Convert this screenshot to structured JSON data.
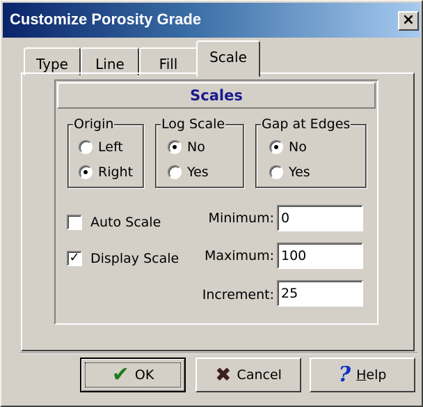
{
  "window": {
    "title": "Customize Porosity Grade",
    "close_label": "×"
  },
  "tabs": [
    {
      "label": "Type"
    },
    {
      "label": "Line"
    },
    {
      "label": "Fill"
    },
    {
      "label": "Scale",
      "selected": true
    }
  ],
  "scales": {
    "header": "Scales",
    "origin": {
      "title": "Origin",
      "options": [
        "Left",
        "Right"
      ],
      "selected": "Right"
    },
    "log_scale": {
      "title": "Log Scale",
      "options": [
        "No",
        "Yes"
      ],
      "selected": "No"
    },
    "gap_at_edges": {
      "title": "Gap at Edges",
      "options": [
        "No",
        "Yes"
      ],
      "selected": "No"
    },
    "auto_scale": {
      "label": "Auto Scale",
      "checked": false,
      "mark": ""
    },
    "display_scale": {
      "label": "Display Scale",
      "checked": true,
      "mark": "✓"
    },
    "minimum": {
      "label": "Minimum:",
      "value": "0"
    },
    "maximum": {
      "label": "Maximum:",
      "value": "100"
    },
    "increment": {
      "label": "Increment:",
      "value": "25"
    }
  },
  "buttons": {
    "ok": {
      "label": "OK",
      "icon": "check-icon"
    },
    "cancel": {
      "label": "Cancel",
      "icon": "x-icon"
    },
    "help": {
      "label_first": "H",
      "label_rest": "elp",
      "icon": "question-icon"
    }
  },
  "icons": {
    "check": "✔",
    "x": "✖",
    "question": "?"
  },
  "colors": {
    "titlebar_start": "#0a246a",
    "titlebar_end": "#a6caf0",
    "face": "#d4d0c8",
    "header_text": "#1a1a8e"
  }
}
